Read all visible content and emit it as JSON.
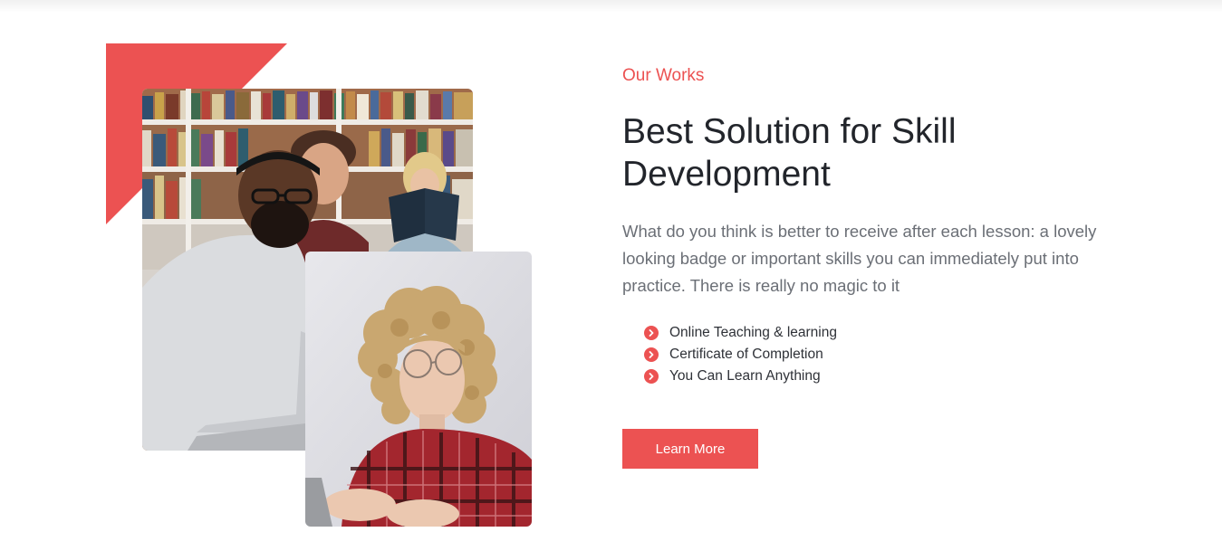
{
  "section": {
    "subtitle": "Our Works",
    "title": "Best Solution for Skill Development",
    "description": "What do you think is better to receive after each lesson: a lovely looking badge or important skills you can immediately put into practice. There is really no magic to it",
    "features": [
      {
        "label": "Online Teaching & learning",
        "icon": "chevron-right-circle-icon"
      },
      {
        "label": "Certificate of Completion",
        "icon": "chevron-right-circle-icon"
      },
      {
        "label": "You Can Learn Anything",
        "icon": "chevron-right-circle-icon"
      }
    ],
    "cta_label": "Learn More"
  },
  "images": {
    "main": "students-in-library-photo",
    "secondary": "student-with-laptop-photo"
  },
  "colors": {
    "accent": "#ec5252",
    "heading": "#22252b",
    "body_text": "#6b6f76",
    "background": "#ffffff"
  }
}
